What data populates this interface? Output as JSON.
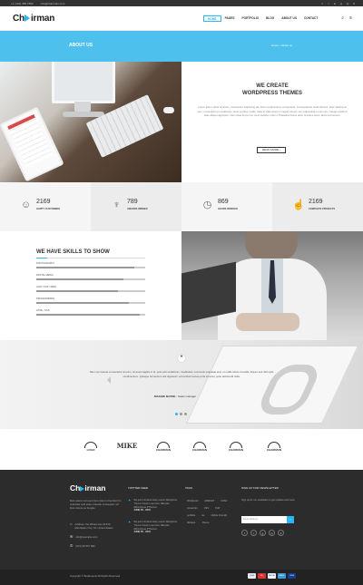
{
  "topbar": {
    "phone": "+1 (123) 456 7890",
    "email": "info@chairman.com",
    "social_icons": [
      "facebook",
      "twitter",
      "linkedin",
      "google-plus",
      "instagram",
      "rss"
    ]
  },
  "header": {
    "logo_prefix": "Ch",
    "logo_suffix": "irman",
    "nav": [
      "HOME",
      "PAGES",
      "PORTFOLIO",
      "BLOG",
      "ABOUT US",
      "CONTACT"
    ],
    "icons": [
      "search-icon",
      "menu-icon"
    ]
  },
  "title_band": {
    "title": "ABOUT US",
    "breadcrumb": "Home > About us"
  },
  "intro": {
    "heading_1": "WE CREATE",
    "heading_2": "WORDPRESS THEMES",
    "paragraph": "Lorem ipsum dolor sit amet, consectetur adipiscing elit. Duis condimentum consectetur, consequat dui nulla ultricies, dolor facilisis at sem, et hendrerit et vestibulum. Nam porttitor mollis, nulla at vitae amet in magna. Donec nec malesuada in est nunc. Integer eleifend vitae aliquet dignissim. Nam vitae turpis non nunc dapibus rutrum. Phasellus luctus dolor tincidunt amet, lacus fermentum.",
    "button": "READ MORE"
  },
  "stats": [
    {
      "icon": "user-icon",
      "number": "2169",
      "label": "HAPPY CUSTOMERS"
    },
    {
      "icon": "trophy-icon",
      "number": "789",
      "label": "AWARDS WINNED"
    },
    {
      "icon": "clock-icon",
      "number": "869",
      "label": "HOURS WORKED"
    },
    {
      "icon": "thumbs-up-icon",
      "number": "2169",
      "label": "COMPLETE PROJECTS"
    }
  ],
  "skills": {
    "title": "WE HAVE SKILLS TO SHOW",
    "items": [
      {
        "label": "PHOTOGRAPHY",
        "value": 0.9
      },
      {
        "label": "DIGITAL MEDIA",
        "value": 0.8
      },
      {
        "label": "JAVA / PHP / PERL",
        "value": 0.75
      },
      {
        "label": "PROGRAMMING",
        "value": 0.85
      },
      {
        "label": "HTML / CSS",
        "value": 0.95
      }
    ]
  },
  "testimonial": {
    "quote": "Nam nec laoreet consectetur at enim, sit amet sagittis in id, quis velit vestibulum. Vestibulum commodo vulputate erat, ut mollis tellus convallis. Donec sed nibh quis condimentum. Quisque fermentum nisl dignissim, at tincidunt lectus porta sit amet, justo lacinia elit nulla.",
    "author": "MAGGIE BASSE",
    "role": "- Sales manager",
    "slides": 3,
    "active_slide": 1
  },
  "clients": [
    "LOGO",
    "MIKE",
    "CHAIRMAN",
    "CHAIRMAN",
    "CHAIRMAN",
    "CHAIRMAN"
  ],
  "footer": {
    "logo_prefix": "Ch",
    "logo_suffix": "irman",
    "about": "Duis autem vel eum iriure dolor in hendrerit in vulputate velit esse molestie consequat, vel illum dolore eu feugiat.",
    "address": "Address: the Widest Ave #1313, Manhattan City, NJ, United States",
    "email": "info@example.com",
    "phone": "(021) 99 567 890",
    "tweets_heading": "TWITTER FEED",
    "tweets": [
      {
        "text": "We just Introduce Easy Lorem Wordpress Theme Check it out here: #Envato #Wordpress #Themes",
        "date": "JUNE 05 - 2015"
      },
      {
        "text": "We just Introduce Easy Lorem Wordpress Theme Check it out here: #Envato #Wordpress #Themes",
        "date": "JUNE 05 - 2015"
      }
    ],
    "tags_heading": "TAGS",
    "tags": [
      "Wordpress",
      "MARKET",
      "CSS3",
      "Javascript",
      "CSS",
      "PHP",
      "portfolio",
      "ios",
      "Mobile Friendly",
      "Website",
      "Theme"
    ],
    "newsletter_heading": "SIGN UP FOR NEWSLETTER",
    "newsletter_text": "Sign up for our newsletter to get updates and news.",
    "newsletter_placeholder": "Email address",
    "social": [
      "facebook",
      "twitter",
      "google-plus",
      "linkedin",
      "rss"
    ],
    "copyright": "Copyright © BeoExperts All Rights Reserved",
    "cards": [
      "VISA",
      "MC",
      "PAYPAL",
      "AMEX",
      "VISA"
    ]
  },
  "colors": {
    "accent": "#29b6f6",
    "title_band": "#4ec0ee",
    "footer": "#2c2c2c"
  }
}
